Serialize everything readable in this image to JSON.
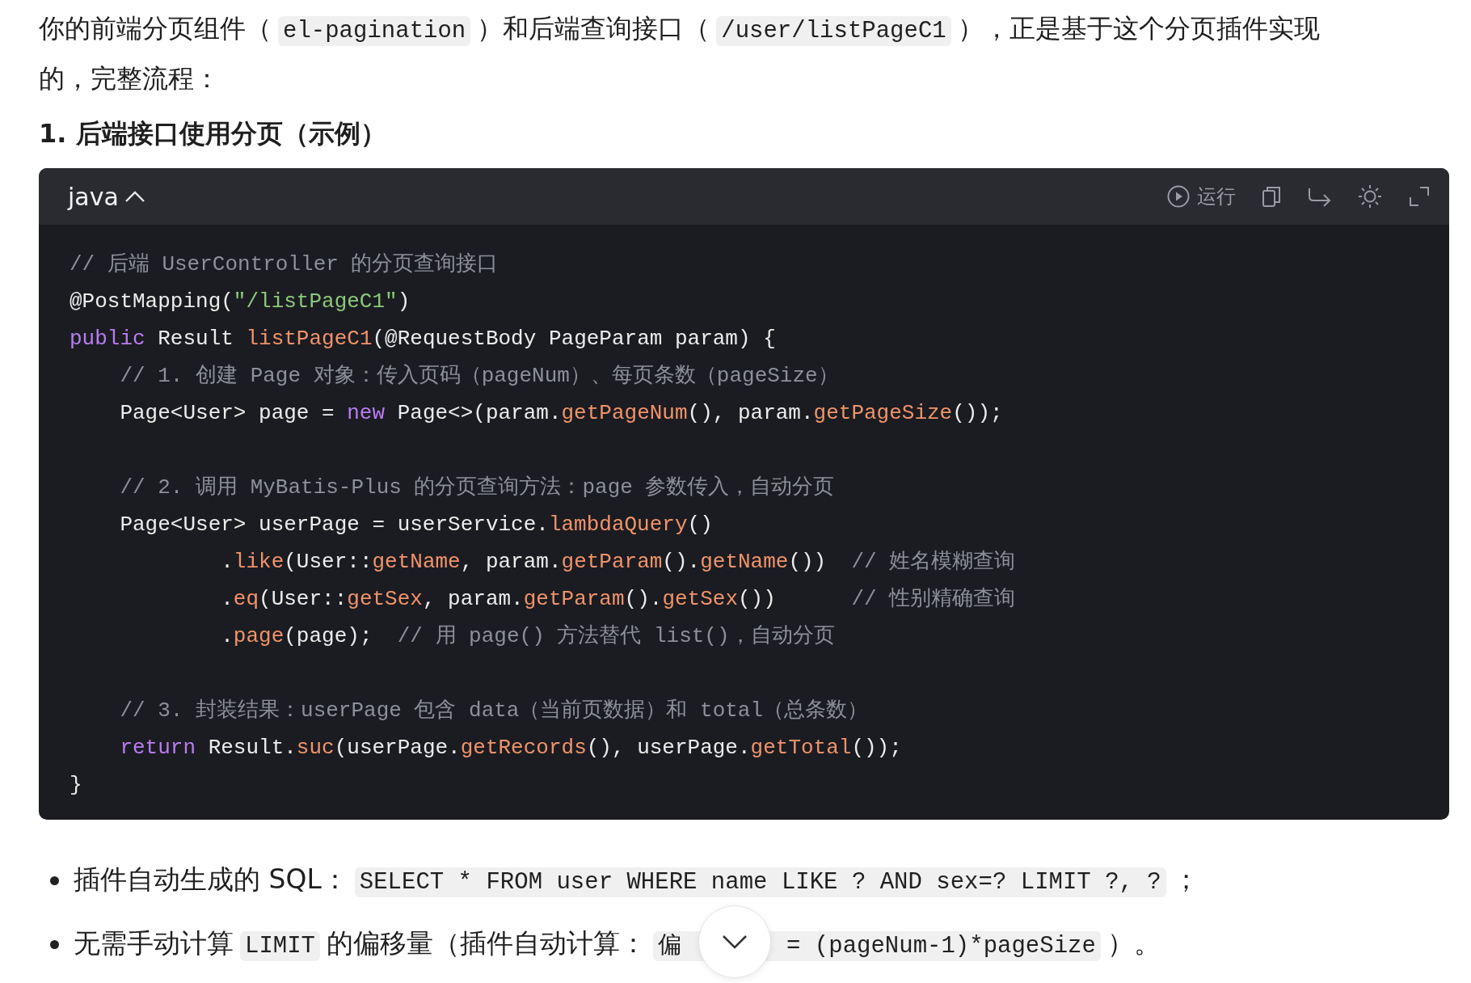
{
  "intro": {
    "parts": [
      {
        "kind": "text",
        "text": "你的前端分页组件（"
      },
      {
        "kind": "code",
        "text": "el-pagination"
      },
      {
        "kind": "text",
        "text": "）和后端查询接口（"
      },
      {
        "kind": "code",
        "text": "/user/listPageC1"
      },
      {
        "kind": "text",
        "text": "），正是基于这个分页插件实现的，完整流程："
      }
    ]
  },
  "heading": "1. 后端接口使用分页（示例）",
  "code_block": {
    "language": "java",
    "toolbar": {
      "run_label": "运行"
    },
    "lines": [
      {
        "kind": "code",
        "tokens": [
          {
            "kind": "comment",
            "text": "// 后端 UserController 的分页查询接口"
          }
        ]
      },
      {
        "kind": "code",
        "tokens": [
          {
            "kind": "plain",
            "text": "@PostMapping("
          },
          {
            "kind": "string",
            "text": "\"/listPageC1\""
          },
          {
            "kind": "plain",
            "text": ")"
          }
        ]
      },
      {
        "kind": "code",
        "tokens": [
          {
            "kind": "keyword",
            "text": "public"
          },
          {
            "kind": "plain",
            "text": " Result "
          },
          {
            "kind": "method",
            "text": "listPageC1"
          },
          {
            "kind": "plain",
            "text": "(@RequestBody PageParam param) {"
          }
        ]
      },
      {
        "kind": "code",
        "tokens": [
          {
            "kind": "comment",
            "text": "    // 1. 创建 Page 对象：传入页码（pageNum）、每页条数（pageSize）"
          }
        ]
      },
      {
        "kind": "code",
        "tokens": [
          {
            "kind": "plain",
            "text": "    Page<User> page = "
          },
          {
            "kind": "keyword",
            "text": "new"
          },
          {
            "kind": "plain",
            "text": " Page<>(param."
          },
          {
            "kind": "method",
            "text": "getPageNum"
          },
          {
            "kind": "plain",
            "text": "(), param."
          },
          {
            "kind": "method",
            "text": "getPageSize"
          },
          {
            "kind": "plain",
            "text": "());"
          }
        ]
      },
      {
        "kind": "blank"
      },
      {
        "kind": "code",
        "tokens": [
          {
            "kind": "comment",
            "text": "    // 2. 调用 MyBatis-Plus 的分页查询方法：page 参数传入，自动分页"
          }
        ]
      },
      {
        "kind": "code",
        "tokens": [
          {
            "kind": "plain",
            "text": "    Page<User> userPage = userService."
          },
          {
            "kind": "method",
            "text": "lambdaQuery"
          },
          {
            "kind": "plain",
            "text": "()"
          }
        ]
      },
      {
        "kind": "code",
        "tokens": [
          {
            "kind": "plain",
            "text": "            ."
          },
          {
            "kind": "method",
            "text": "like"
          },
          {
            "kind": "plain",
            "text": "(User::"
          },
          {
            "kind": "method",
            "text": "getName"
          },
          {
            "kind": "plain",
            "text": ", param."
          },
          {
            "kind": "method",
            "text": "getParam"
          },
          {
            "kind": "plain",
            "text": "()."
          },
          {
            "kind": "method",
            "text": "getName"
          },
          {
            "kind": "plain",
            "text": "())  "
          },
          {
            "kind": "comment",
            "text": "// 姓名模糊查询"
          }
        ]
      },
      {
        "kind": "code",
        "tokens": [
          {
            "kind": "plain",
            "text": "            ."
          },
          {
            "kind": "method",
            "text": "eq"
          },
          {
            "kind": "plain",
            "text": "(User::"
          },
          {
            "kind": "method",
            "text": "getSex"
          },
          {
            "kind": "plain",
            "text": ", param."
          },
          {
            "kind": "method",
            "text": "getParam"
          },
          {
            "kind": "plain",
            "text": "()."
          },
          {
            "kind": "method",
            "text": "getSex"
          },
          {
            "kind": "plain",
            "text": "())      "
          },
          {
            "kind": "comment",
            "text": "// 性别精确查询"
          }
        ]
      },
      {
        "kind": "code",
        "tokens": [
          {
            "kind": "plain",
            "text": "            ."
          },
          {
            "kind": "method",
            "text": "page"
          },
          {
            "kind": "plain",
            "text": "(page);  "
          },
          {
            "kind": "comment",
            "text": "// 用 page() 方法替代 list()，自动分页"
          }
        ]
      },
      {
        "kind": "blank"
      },
      {
        "kind": "code",
        "tokens": [
          {
            "kind": "comment",
            "text": "    // 3. 封装结果：userPage 包含 data（当前页数据）和 total（总条数）"
          }
        ]
      },
      {
        "kind": "code",
        "tokens": [
          {
            "kind": "keyword",
            "text": "    return"
          },
          {
            "kind": "plain",
            "text": " Result."
          },
          {
            "kind": "method",
            "text": "suc"
          },
          {
            "kind": "plain",
            "text": "(userPage."
          },
          {
            "kind": "method",
            "text": "getRecords"
          },
          {
            "kind": "plain",
            "text": "(), userPage."
          },
          {
            "kind": "method",
            "text": "getTotal"
          },
          {
            "kind": "plain",
            "text": "());"
          }
        ]
      },
      {
        "kind": "code",
        "tokens": [
          {
            "kind": "plain",
            "text": "}"
          }
        ]
      }
    ]
  },
  "bullets": [
    {
      "parts": [
        {
          "kind": "text",
          "text": "插件自动生成的 SQL："
        },
        {
          "kind": "code",
          "text": "SELECT * FROM user WHERE name LIKE ? AND sex=? LIMIT ?, ?"
        },
        {
          "kind": "text",
          "text": "；"
        }
      ]
    },
    {
      "parts": [
        {
          "kind": "text",
          "text": "无需手动计算"
        },
        {
          "kind": "code",
          "text": "LIMIT"
        },
        {
          "kind": "text",
          "text": "的偏移量（插件自动计算："
        },
        {
          "kind": "covered_code",
          "before": "偏",
          "after": "= (pageNum-1)*pageSize"
        },
        {
          "kind": "text",
          "text": "）。"
        }
      ]
    }
  ]
}
